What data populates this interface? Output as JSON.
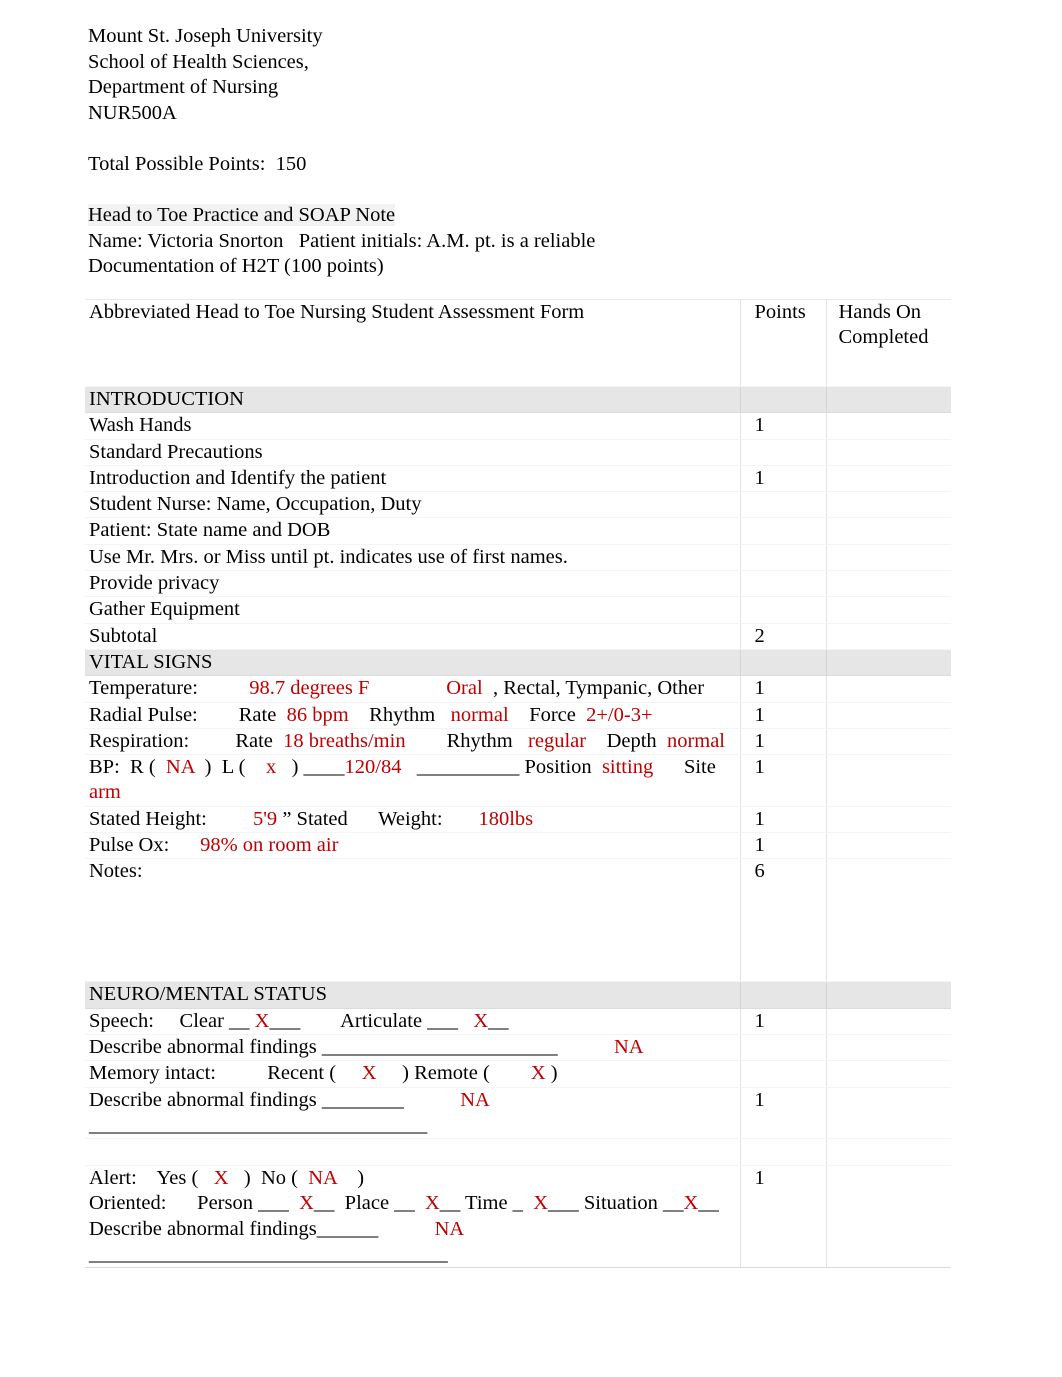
{
  "header": {
    "lines": [
      "Mount St. Joseph University",
      "School of Health Sciences,",
      "Department of Nursing",
      "NUR500A"
    ],
    "total_points": "Total Possible Points:  150",
    "assignment_title": "Head to Toe Practice and SOAP Note",
    "name_line": "Name: Victoria Snorton   Patient initials: A.M. pt. is a reliable",
    "documentation_line": "Documentation of H2T (100 points)"
  },
  "table": {
    "columns": {
      "description": "Abbreviated Head to Toe Nursing Student Assessment Form",
      "points": "Points",
      "hands_on": "Hands On Completed"
    },
    "rows": [
      {
        "type": "section",
        "desc": "INTRODUCTION",
        "points": "",
        "hands": ""
      },
      {
        "type": "item",
        "desc": "Wash Hands",
        "points": "1",
        "hands": ""
      },
      {
        "type": "item",
        "desc": "Standard Precautions",
        "points": "",
        "hands": ""
      },
      {
        "type": "item",
        "desc": "Introduction and Identify the patient",
        "points": "1",
        "hands": ""
      },
      {
        "type": "item",
        "desc": "Student Nurse: Name, Occupation, Duty",
        "points": "",
        "hands": ""
      },
      {
        "type": "item",
        "desc": "Patient: State name and DOB",
        "points": "",
        "hands": ""
      },
      {
        "type": "item",
        "desc": "Use Mr. Mrs. or Miss until pt. indicates use of first names.",
        "points": "",
        "hands": ""
      },
      {
        "type": "item",
        "desc": "Provide privacy",
        "points": "",
        "hands": ""
      },
      {
        "type": "item",
        "desc": "Gather Equipment",
        "points": "",
        "hands": ""
      },
      {
        "type": "item",
        "desc": "Subtotal",
        "points": "2",
        "hands": ""
      },
      {
        "type": "section",
        "desc": "VITAL SIGNS",
        "points": "",
        "hands": ""
      },
      {
        "type": "rich",
        "name": "temperature-row",
        "points": "1",
        "hands": "",
        "parts": [
          {
            "t": "Temperature:          ",
            "c": "black"
          },
          {
            "t": "98.7 degrees F",
            "c": "red"
          },
          {
            "t": "               ",
            "c": "black"
          },
          {
            "t": "Oral",
            "c": "red"
          },
          {
            "t": "  , Rectal, Tympanic, Other",
            "c": "black"
          }
        ]
      },
      {
        "type": "rich",
        "name": "radial-pulse-row",
        "points": "1",
        "hands": "",
        "parts": [
          {
            "t": "Radial Pulse:        Rate  ",
            "c": "black"
          },
          {
            "t": "86 bpm",
            "c": "red"
          },
          {
            "t": "    Rhythm   ",
            "c": "black"
          },
          {
            "t": "normal",
            "c": "red"
          },
          {
            "t": "    Force  ",
            "c": "black"
          },
          {
            "t": "2+/0-3+",
            "c": "red"
          }
        ]
      },
      {
        "type": "rich",
        "name": "respiration-row",
        "points": "1",
        "hands": "",
        "parts": [
          {
            "t": "Respiration:         Rate  ",
            "c": "black"
          },
          {
            "t": "18 breaths/min",
            "c": "red"
          },
          {
            "t": "        Rhythm   ",
            "c": "black"
          },
          {
            "t": "regular",
            "c": "red"
          },
          {
            "t": "    Depth  ",
            "c": "black"
          },
          {
            "t": "normal",
            "c": "red"
          }
        ]
      },
      {
        "type": "rich",
        "name": "blood-pressure-row",
        "points": "1",
        "hands": "",
        "parts": [
          {
            "t": "BP:  R (  ",
            "c": "black"
          },
          {
            "t": "NA",
            "c": "red"
          },
          {
            "t": "  )  L (    ",
            "c": "black"
          },
          {
            "t": "x",
            "c": "red"
          },
          {
            "t": "   ) ____",
            "c": "black"
          },
          {
            "t": "120/84",
            "c": "red"
          },
          {
            "t": "   __________ Position  ",
            "c": "black"
          },
          {
            "t": "sitting",
            "c": "red"
          },
          {
            "t": "      Site   ",
            "c": "black"
          },
          {
            "t": "arm",
            "c": "red"
          }
        ]
      },
      {
        "type": "rich",
        "name": "height-weight-row",
        "points": "1",
        "hands": "",
        "parts": [
          {
            "t": "Stated Height:         ",
            "c": "black"
          },
          {
            "t": "5'9",
            "c": "red"
          },
          {
            "t": " ” Stated      Weight:       ",
            "c": "black"
          },
          {
            "t": "180lbs",
            "c": "red"
          }
        ]
      },
      {
        "type": "rich",
        "name": "pulse-ox-row",
        "points": "1",
        "hands": "",
        "parts": [
          {
            "t": "Pulse Ox:      ",
            "c": "black"
          },
          {
            "t": "98% on room air",
            "c": "red"
          }
        ]
      },
      {
        "type": "item",
        "name": "notes-row",
        "desc": "Notes:",
        "points": "6",
        "hands": "",
        "tall": true
      },
      {
        "type": "section",
        "desc": "NEURO/MENTAL STATUS",
        "points": "",
        "hands": ""
      },
      {
        "type": "rich",
        "name": "speech-row",
        "points": "1",
        "hands": "",
        "parts": [
          {
            "t": "Speech:     Clear __ ",
            "c": "black"
          },
          {
            "t": "X",
            "c": "red"
          },
          {
            "t": "___        Articulate ___   ",
            "c": "black"
          },
          {
            "t": "X",
            "c": "red"
          },
          {
            "t": "__",
            "c": "black"
          }
        ]
      },
      {
        "type": "rich",
        "name": "speech-abnormal-row",
        "points": "",
        "hands": "",
        "parts": [
          {
            "t": "Describe abnormal findings _______________________           ",
            "c": "black"
          },
          {
            "t": "NA",
            "c": "red"
          }
        ]
      },
      {
        "type": "rich",
        "name": "memory-row",
        "points": "",
        "hands": "",
        "parts": [
          {
            "t": "Memory intact:          Recent (     ",
            "c": "black"
          },
          {
            "t": "X",
            "c": "red"
          },
          {
            "t": "     ) Remote (        ",
            "c": "black"
          },
          {
            "t": "X",
            "c": "red"
          },
          {
            "t": " )",
            "c": "black"
          }
        ]
      },
      {
        "type": "rich",
        "name": "memory-abnormal-row",
        "points": "1",
        "hands": "",
        "parts": [
          {
            "t": "Describe abnormal findings ________           ",
            "c": "black"
          },
          {
            "t": "NA",
            "c": "red"
          },
          {
            "t": "\n_________________________________",
            "c": "black"
          }
        ]
      },
      {
        "type": "gap",
        "desc": "",
        "points": "",
        "hands": ""
      },
      {
        "type": "rich",
        "name": "alert-oriented-row",
        "points": "1",
        "hands": "",
        "parts": [
          {
            "t": "Alert:    Yes (   ",
            "c": "black"
          },
          {
            "t": "X",
            "c": "red"
          },
          {
            "t": "   )  No (  ",
            "c": "black"
          },
          {
            "t": "NA",
            "c": "red"
          },
          {
            "t": "    )\nOriented:      Person ___  ",
            "c": "black"
          },
          {
            "t": "X",
            "c": "red"
          },
          {
            "t": "__  Place __  ",
            "c": "black"
          },
          {
            "t": "X",
            "c": "red"
          },
          {
            "t": "__ Time _  ",
            "c": "black"
          },
          {
            "t": "X",
            "c": "red"
          },
          {
            "t": "___ Situation __",
            "c": "black"
          },
          {
            "t": "X",
            "c": "red"
          },
          {
            "t": "__\nDescribe abnormal findings______           ",
            "c": "black"
          },
          {
            "t": "NA",
            "c": "red"
          },
          {
            "t": "\n___________________________________",
            "c": "black"
          }
        ]
      }
    ]
  },
  "colors": {
    "entry_red": "#c00000",
    "section_gray": "#e6e6e6",
    "highlight_gray": "#f2f2f2"
  }
}
